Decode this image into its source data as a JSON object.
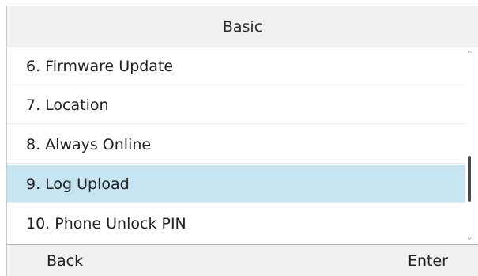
{
  "header": {
    "title": "Basic"
  },
  "menu": {
    "items": [
      {
        "label": "6. Firmware Update",
        "selected": false
      },
      {
        "label": "7. Location",
        "selected": false
      },
      {
        "label": "8. Always Online",
        "selected": false
      },
      {
        "label": "9. Log Upload",
        "selected": true
      },
      {
        "label": "10. Phone Unlock PIN",
        "selected": false
      }
    ]
  },
  "scrollbar": {
    "up_icon": "chevron-up-icon",
    "down_icon": "chevron-down-icon"
  },
  "softkeys": {
    "back_label": "Back",
    "enter_label": "Enter"
  },
  "colors": {
    "selected_row": "#c6e4f1",
    "bar_background": "#eef0f2"
  }
}
